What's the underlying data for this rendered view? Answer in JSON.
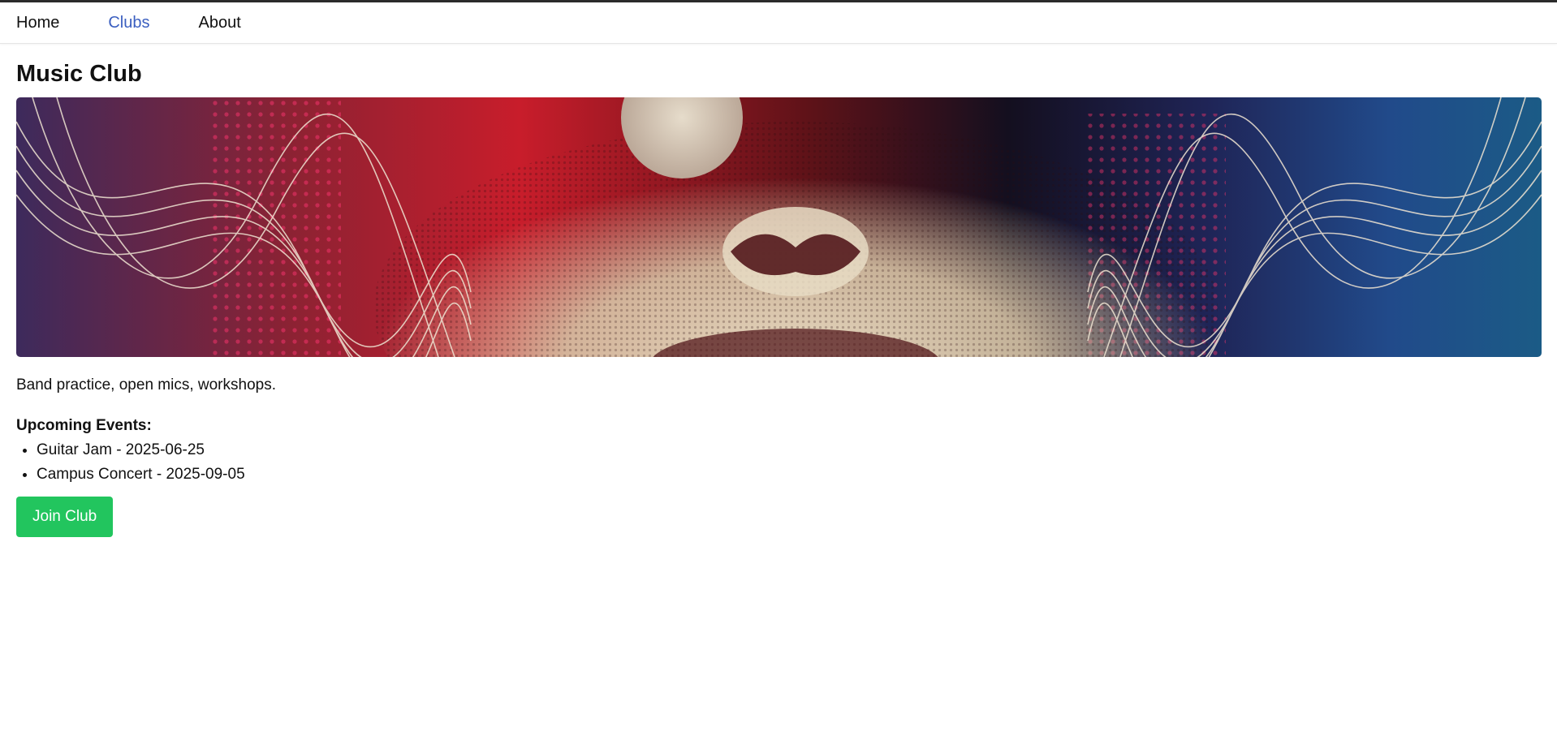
{
  "nav": {
    "items": [
      {
        "label": "Home",
        "active": false
      },
      {
        "label": "Clubs",
        "active": true
      },
      {
        "label": "About",
        "active": false
      }
    ]
  },
  "club": {
    "title": "Music Club",
    "banner_icon": "abstract-music-banner-image",
    "description": "Band practice, open mics, workshops.",
    "events_heading": "Upcoming Events:",
    "events": [
      "Guitar Jam - 2025-06-25",
      "Campus Concert - 2025-09-05"
    ],
    "join_label": "Join Club"
  },
  "colors": {
    "accent_link": "#3b5fc0",
    "join_button": "#22c55e",
    "topbar": "#2b2b2b"
  }
}
